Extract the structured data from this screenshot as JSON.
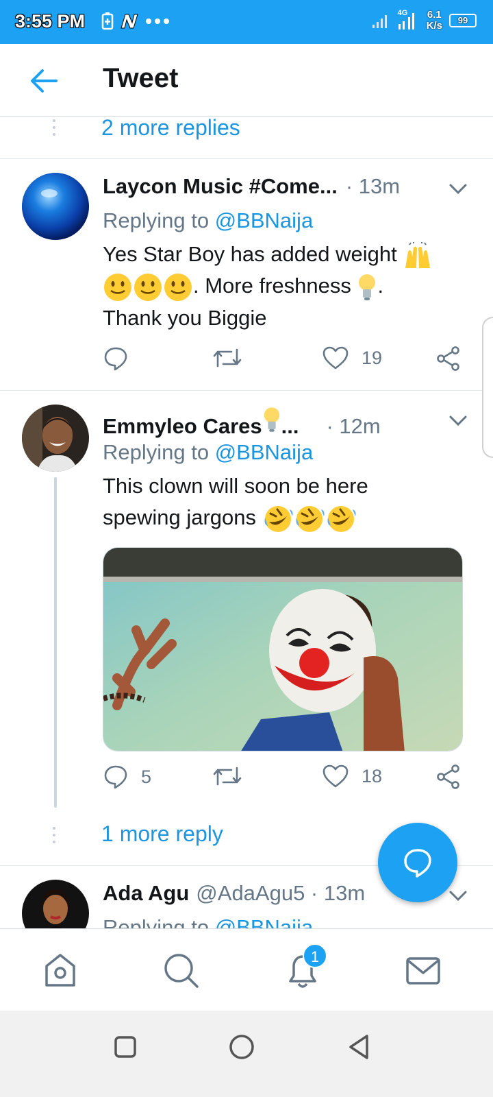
{
  "status_bar": {
    "time": "3:55 PM",
    "network": "4G",
    "speed_top": "6.1",
    "speed_bottom": "K/s",
    "battery": "99"
  },
  "header": {
    "title": "Tweet",
    "back_icon": "arrow-left-icon"
  },
  "thread": {
    "more_replies_top": "2 more replies",
    "more_replies_bottom": "1 more reply"
  },
  "tweets": [
    {
      "name": "Laycon Music #Come...",
      "meta": " · 13m",
      "replying_prefix": "Replying to ",
      "replying_handle": "@BBNaija",
      "text_1": "Yes Star Boy has added weight ",
      "text_2": ". More freshness ",
      "text_3": ".",
      "text_4": "Thank you Biggie",
      "emojis": [
        "raising-hands",
        "slightly-smiling",
        "slightly-smiling",
        "slightly-smiling",
        "light-bulb"
      ],
      "reply_count": "",
      "retweet_count": "",
      "like_count": "19"
    },
    {
      "name": "Emmyleo Cares ",
      "name_suffix": " ...",
      "meta": " · 12m",
      "replying_prefix": "Replying to ",
      "replying_handle": "@BBNaija",
      "text_1": "This clown will soon be here",
      "text_2": "spewing jargons ",
      "emojis": [
        "light-bulb",
        "rolling-laughing",
        "rolling-laughing",
        "rolling-laughing"
      ],
      "reply_count": "5",
      "retweet_count": "",
      "like_count": "18"
    },
    {
      "name": "Ada Agu",
      "meta": " @AdaAgu5 · 13m",
      "replying_prefix": "Replying to ",
      "replying_handle": "@BBNaija"
    }
  ],
  "bottom_nav": {
    "items": [
      "home-icon",
      "search-icon",
      "notifications-icon",
      "messages-icon"
    ],
    "notification_badge": "1"
  },
  "colors": {
    "accent": "#1da1f2",
    "link": "#1b95e0",
    "secondary_text": "#657786"
  }
}
